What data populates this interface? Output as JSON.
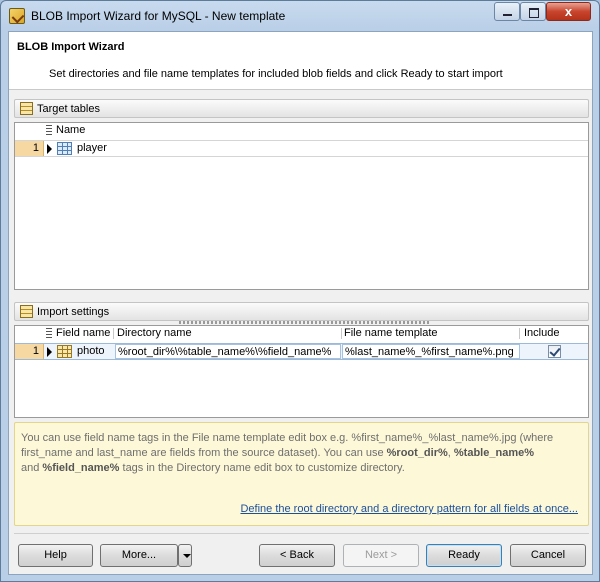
{
  "window": {
    "title": "BLOB Import Wizard for MySQL - New template",
    "close_glyph": "x"
  },
  "header": {
    "title": "BLOB Import Wizard",
    "description": "Set directories and file name templates for included blob fields and click Ready to start import"
  },
  "target_tables": {
    "label": "Target tables",
    "columns": [
      "Name"
    ],
    "rows": [
      {
        "num": "1",
        "name": "player"
      }
    ]
  },
  "import_settings": {
    "label": "Import settings",
    "columns": [
      "Field name",
      "Directory name",
      "File name template",
      "Include"
    ],
    "rows": [
      {
        "num": "1",
        "field_name": "photo",
        "directory_name": "%root_dir%\\%table_name%\\%field_name%",
        "file_name_template": "%last_name%_%first_name%.png",
        "include": true
      }
    ]
  },
  "hint": {
    "line1": "You can use field name tags in the File name template edit box e.g. %first_name%_%last_name%.jpg (where",
    "line2_pre": "first_name and last_name are fields from the source dataset). You can use ",
    "tag_root": "%root_dir%",
    "sep1": ", ",
    "tag_table": "%table_name%",
    "line3_pre": "and ",
    "tag_field": "%field_name%",
    "line3_post": " tags in the Directory name edit box to customize directory.",
    "link": "Define the root directory and a directory pattern for all fields at once..."
  },
  "buttons": {
    "help": "Help",
    "more": "More...",
    "back": "< Back",
    "next": "Next >",
    "ready": "Ready",
    "cancel": "Cancel"
  },
  "colors": {
    "row_number_bg": "#f6d9a2",
    "hint_bg": "#fdf8d8",
    "link": "#1c4f9c"
  }
}
